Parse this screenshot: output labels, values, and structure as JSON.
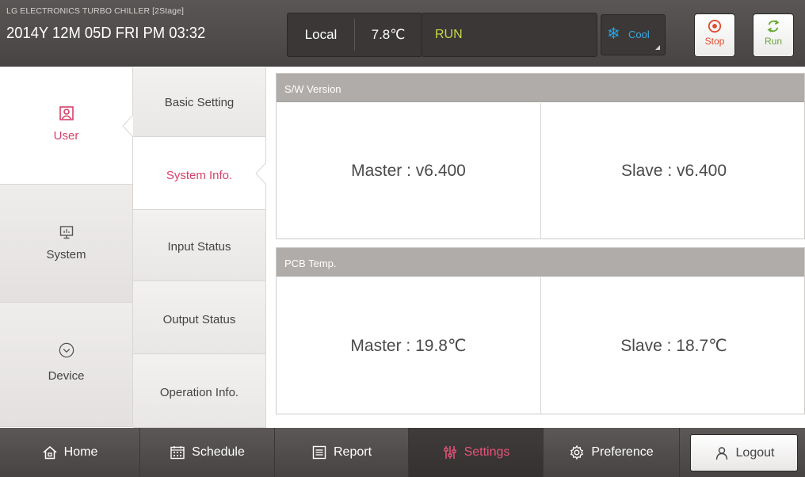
{
  "header": {
    "title": "LG ELECTRONICS TURBO CHILLER [2Stage]",
    "datetime": "2014Y 12M 05D  FRI PM 03:32",
    "mode": "Local",
    "temperature": "7.8℃",
    "run_status": "RUN",
    "cool_label": "Cool",
    "stop_label": "Stop",
    "run_label": "Run",
    "colors": {
      "run_status": "#c6d84a",
      "cool": "#3aa9e2",
      "stop": "#e0492b",
      "run": "#65a832",
      "accent": "#d5416a"
    }
  },
  "categories": [
    {
      "label": "User",
      "icon": "user-icon",
      "active": true
    },
    {
      "label": "System",
      "icon": "monitor-icon",
      "active": false
    },
    {
      "label": "Device",
      "icon": "check-circle-icon",
      "active": false
    }
  ],
  "submenu": [
    {
      "label": "Basic Setting",
      "active": false
    },
    {
      "label": "System Info.",
      "active": true
    },
    {
      "label": "Input Status",
      "active": false
    },
    {
      "label": "Output Status",
      "active": false
    },
    {
      "label": "Operation Info.",
      "active": false
    }
  ],
  "sw_version": {
    "title": "S/W Version",
    "master": "Master : v6.400",
    "slave": "Slave : v6.400"
  },
  "pcb_temp": {
    "title": "PCB Temp.",
    "master": "Master : 19.8℃",
    "slave": "Slave : 18.7℃"
  },
  "bottom_nav": [
    {
      "label": "Home",
      "icon": "home-icon",
      "active": false
    },
    {
      "label": "Schedule",
      "icon": "calendar-icon",
      "active": false
    },
    {
      "label": "Report",
      "icon": "report-icon",
      "active": false
    },
    {
      "label": "Settings",
      "icon": "settings-icon",
      "active": true
    },
    {
      "label": "Preference",
      "icon": "gear-icon",
      "active": false
    }
  ],
  "logout_label": "Logout"
}
